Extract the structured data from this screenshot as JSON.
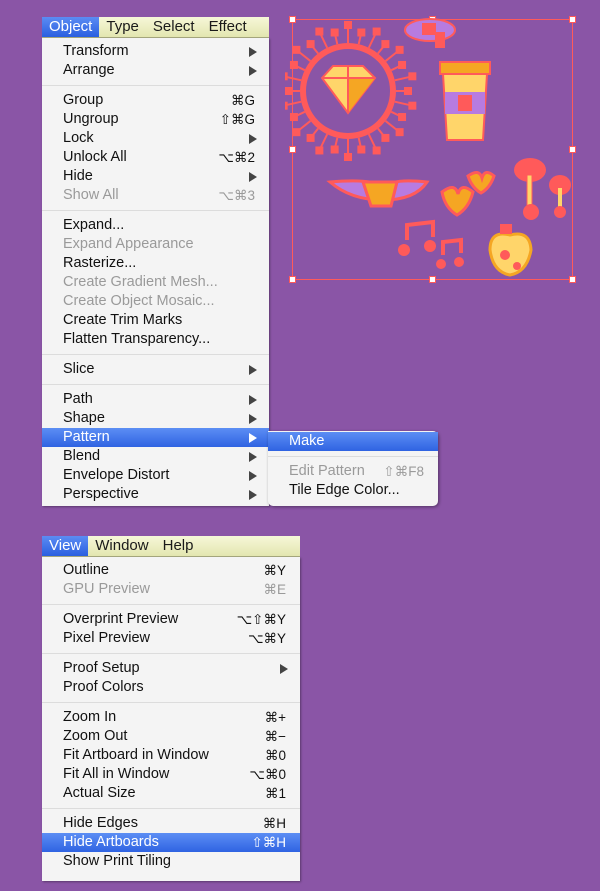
{
  "object_menu": {
    "menubar": [
      "Object",
      "Type",
      "Select",
      "Effect"
    ],
    "items": [
      {
        "label": "Transform",
        "submenu": true
      },
      {
        "label": "Arrange",
        "submenu": true
      },
      {
        "separator": true
      },
      {
        "label": "Group",
        "shortcut": "⌘G"
      },
      {
        "label": "Ungroup",
        "shortcut": "⇧⌘G"
      },
      {
        "label": "Lock",
        "submenu": true
      },
      {
        "label": "Unlock All",
        "shortcut": "⌥⌘2"
      },
      {
        "label": "Hide",
        "submenu": true
      },
      {
        "label": "Show All",
        "shortcut": "⌥⌘3",
        "disabled": true
      },
      {
        "separator": true
      },
      {
        "label": "Expand..."
      },
      {
        "label": "Expand Appearance",
        "disabled": true
      },
      {
        "label": "Rasterize..."
      },
      {
        "label": "Create Gradient Mesh...",
        "disabled": true
      },
      {
        "label": "Create Object Mosaic...",
        "disabled": true
      },
      {
        "label": "Create Trim Marks"
      },
      {
        "label": "Flatten Transparency..."
      },
      {
        "separator": true
      },
      {
        "label": "Slice",
        "submenu": true
      },
      {
        "separator": true
      },
      {
        "label": "Path",
        "submenu": true
      },
      {
        "label": "Shape",
        "submenu": true
      },
      {
        "label": "Pattern",
        "submenu": true,
        "highlighted": true
      },
      {
        "label": "Blend",
        "submenu": true
      },
      {
        "label": "Envelope Distort",
        "submenu": true
      },
      {
        "label": "Perspective",
        "submenu": true
      }
    ]
  },
  "pattern_submenu": {
    "items": [
      {
        "label": "Make",
        "highlighted": true
      },
      {
        "separator": true
      },
      {
        "label": "Edit Pattern",
        "shortcut": "⇧⌘F8",
        "disabled": true
      },
      {
        "label": "Tile Edge Color..."
      }
    ]
  },
  "view_menu": {
    "menubar": [
      "View",
      "Window",
      "Help"
    ],
    "items": [
      {
        "label": "Outline",
        "shortcut": "⌘Y"
      },
      {
        "label": "GPU Preview",
        "shortcut": "⌘E",
        "disabled": true
      },
      {
        "separator": true
      },
      {
        "label": "Overprint Preview",
        "shortcut": "⌥⇧⌘Y"
      },
      {
        "label": "Pixel Preview",
        "shortcut": "⌥⌘Y"
      },
      {
        "separator": true
      },
      {
        "label": "Proof Setup",
        "submenu": true
      },
      {
        "label": "Proof Colors"
      },
      {
        "separator": true
      },
      {
        "label": "Zoom In",
        "shortcut": "⌘+"
      },
      {
        "label": "Zoom Out",
        "shortcut": "⌘−"
      },
      {
        "label": "Fit Artboard in Window",
        "shortcut": "⌘0"
      },
      {
        "label": "Fit All in Window",
        "shortcut": "⌥⌘0"
      },
      {
        "label": "Actual Size",
        "shortcut": "⌘1"
      },
      {
        "separator": true
      },
      {
        "label": "Hide Edges",
        "shortcut": "⌘H"
      },
      {
        "label": "Hide Artboards",
        "shortcut": "⇧⌘H",
        "highlighted": true
      },
      {
        "label": "Show Print Tiling"
      }
    ]
  },
  "artwork": {
    "icons": [
      "diamond-sun-icon",
      "speech-bubble-icon",
      "coffee-cup-icon",
      "mustache-icon",
      "hearts-icon",
      "mushrooms-icon",
      "music-notes-icon",
      "apple-icon"
    ],
    "colors": {
      "background": "#8a55a6",
      "selection": "#ff5a5a",
      "yellow": "#ffd56a",
      "orange": "#f5a623",
      "lavender": "#b77be0"
    }
  }
}
